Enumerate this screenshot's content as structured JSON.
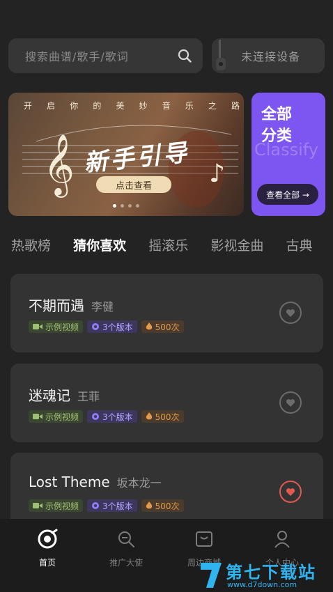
{
  "search": {
    "placeholder": "搜索曲谱/歌手/歌词"
  },
  "device": {
    "status": "未连接设备"
  },
  "banner": {
    "top_chars": [
      "开",
      "启",
      "你",
      "的",
      "美",
      "妙",
      "音",
      "乐",
      "之",
      "路"
    ],
    "title": "新手引导",
    "button": "点击查看",
    "dots": 4,
    "active_dot": 0
  },
  "classify": {
    "title": "全部分类",
    "en": "Classify",
    "button": "查看全部 →"
  },
  "tabs": [
    {
      "label": "热歌榜",
      "active": false
    },
    {
      "label": "猜你喜欢",
      "active": true
    },
    {
      "label": "摇滚乐",
      "active": false
    },
    {
      "label": "影视金曲",
      "active": false
    },
    {
      "label": "古典",
      "active": false
    }
  ],
  "songs": [
    {
      "title": "不期而遇",
      "artist": "李健",
      "video": "示例视频",
      "versions": "3个版本",
      "plays": "500次",
      "liked": false
    },
    {
      "title": "迷魂记",
      "artist": "王菲",
      "video": "示例视频",
      "versions": "3个版本",
      "plays": "500次",
      "liked": false
    },
    {
      "title": "Lost Theme",
      "artist": "坂本龙一",
      "video": "示例视频",
      "versions": "3个版本",
      "plays": "500次",
      "liked": true
    }
  ],
  "nav": [
    {
      "label": "首页",
      "icon": "home-disc-icon",
      "active": true
    },
    {
      "label": "推广大使",
      "icon": "megaphone-icon",
      "active": false
    },
    {
      "label": "周边商城",
      "icon": "shop-box-icon",
      "active": false
    },
    {
      "label": "个人中心",
      "icon": "profile-icon",
      "active": false
    }
  ],
  "watermark": {
    "title": "第七下载站",
    "url": "www.d7down.com"
  },
  "colors": {
    "accent_purple": "#7d55f0",
    "like_red": "#e25a4f",
    "background": "#232323",
    "card": "#333333"
  }
}
